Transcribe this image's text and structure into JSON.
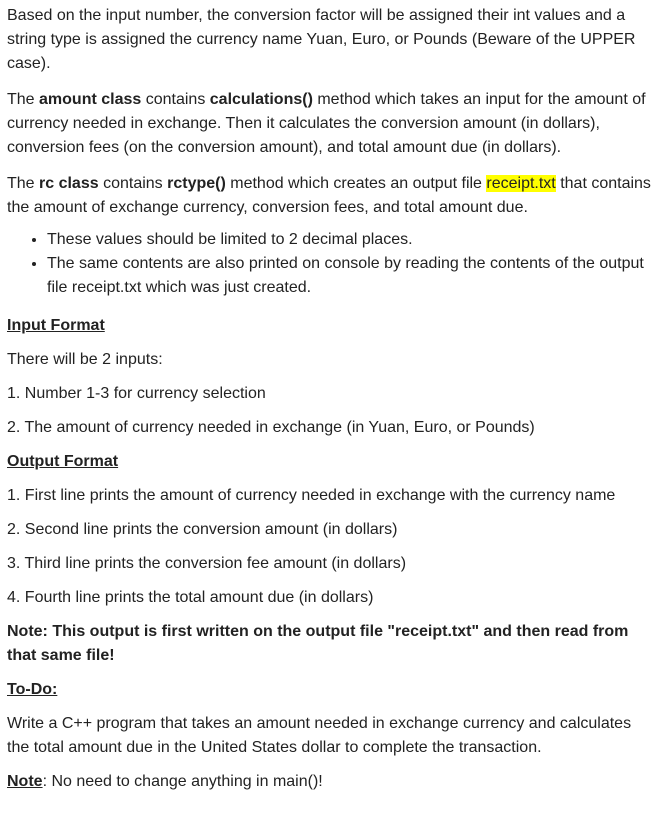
{
  "intro": {
    "p1": "Based on the input number, the conversion factor will be assigned their int values and a string type is assigned the currency name Yuan, Euro, or Pounds (Beware of the UPPER case).",
    "p2_pre": "The ",
    "p2_bold1": "amount class",
    "p2_mid": " contains ",
    "p2_bold2": "calculations()",
    "p2_post": " method which takes an input for the amount of currency needed in exchange. Then it calculates the conversion amount (in dollars), conversion fees (on the conversion amount), and total amount due (in dollars).",
    "p3_pre": "The ",
    "p3_bold1": "rc class",
    "p3_mid": " contains ",
    "p3_bold2": "rctype()",
    "p3_mid2": " method which creates an output file ",
    "p3_highlight": "receipt.txt",
    "p3_post": " that contains the amount of exchange currency, conversion fees, and total amount due.",
    "bullets": [
      "These values should be limited to 2 decimal places.",
      "The same contents are also printed on console by reading the contents of the output file receipt.txt which was just created."
    ]
  },
  "input_format": {
    "heading": "Input Format",
    "lines": [
      "There will be 2 inputs:",
      "1. Number 1-3 for currency selection",
      "2. The amount of currency needed in exchange (in Yuan, Euro, or Pounds)"
    ]
  },
  "output_format": {
    "heading": "Output Format",
    "lines": [
      "1. First line prints the amount of currency needed in exchange with the currency name",
      "2. Second line prints the conversion amount (in dollars)",
      "3. Third line prints the conversion fee amount (in dollars)",
      "4. Fourth line prints the total amount due (in dollars)"
    ],
    "note": "Note: This output is first written on the output file \"receipt.txt\" and then read from that same file!"
  },
  "todo": {
    "heading": "To-Do:",
    "text": "Write a C++ program that takes an amount needed in exchange currency and calculates the total amount due in the United States dollar to complete the transaction."
  },
  "final_note": {
    "label": "Note",
    "text": ": No need to change anything in main()!"
  },
  "colors": {
    "highlight": "#ffff00",
    "text": "#222222"
  }
}
